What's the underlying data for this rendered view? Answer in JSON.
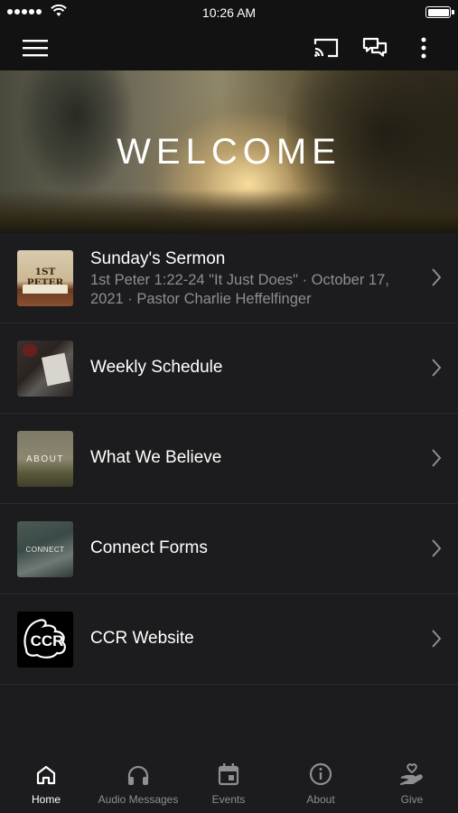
{
  "status_bar": {
    "time": "10:26 AM"
  },
  "header": {
    "icons": [
      "menu-icon",
      "cast-icon",
      "chat-icon",
      "more-vertical-icon"
    ]
  },
  "hero": {
    "title": "WELCOME"
  },
  "list": {
    "items": [
      {
        "title": "Sunday's Sermon",
        "subtitle": "1st Peter 1:22-24 \"It Just Does\" · October 17, 2021 · Pastor Charlie Heffelfinger",
        "thumb_label": "1ST PETER"
      },
      {
        "title": "Weekly Schedule"
      },
      {
        "title": "What We Believe",
        "thumb_label": "ABOUT"
      },
      {
        "title": "Connect Forms",
        "thumb_label": "CONNECT"
      },
      {
        "title": "CCR Website",
        "thumb_label": "CCR"
      }
    ]
  },
  "tabs": [
    {
      "label": "Home",
      "icon": "home-icon",
      "active": true
    },
    {
      "label": "Audio Messages",
      "icon": "headphones-icon"
    },
    {
      "label": "Events",
      "icon": "calendar-icon"
    },
    {
      "label": "About",
      "icon": "info-icon"
    },
    {
      "label": "Give",
      "icon": "give-hand-heart-icon"
    }
  ],
  "colors": {
    "background": "#1c1c1e",
    "header": "#121212",
    "text": "#ffffff",
    "secondary_text": "#8e8e93"
  }
}
